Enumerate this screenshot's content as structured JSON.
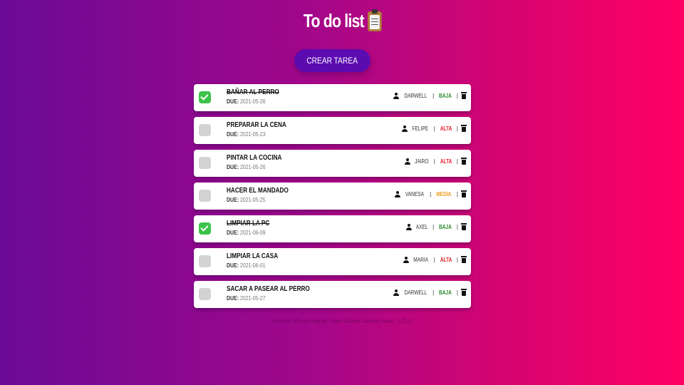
{
  "header": {
    "title": "To do list",
    "title_icon": "clipboard-icon"
  },
  "create_button": {
    "label": "CREAR TAREA"
  },
  "due_label": "DUE:",
  "colors": {
    "priority_baja": "#2a8a2a",
    "priority_alta": "#e8202a",
    "priority_media": "#f0a020",
    "checkbox_done": "#3cc24a",
    "checkbox_pending": "#d3d3d3",
    "button_bg": "#5b0bb0"
  },
  "tasks": [
    {
      "name": "BAÑAR AL PERRO",
      "due": "2021-05-26",
      "done": true,
      "assignee": "DARWELL",
      "priority": "BAJA",
      "priority_color": "#2a8a2a"
    },
    {
      "name": "PREPARAR LA CENA",
      "due": "2021-05-23",
      "done": false,
      "assignee": "FELIPE",
      "priority": "ALTA",
      "priority_color": "#e8202a"
    },
    {
      "name": "PINTAR LA COCINA",
      "due": "2021-05-26",
      "done": false,
      "assignee": "JAIRO",
      "priority": "ALTA",
      "priority_color": "#e8202a"
    },
    {
      "name": "HACER EL MANDADO",
      "due": "2021-05-25",
      "done": false,
      "assignee": "VANESA",
      "priority": "MEDIA",
      "priority_color": "#f0a020"
    },
    {
      "name": "LIMPIAR LA PC",
      "due": "2021-06-09",
      "done": true,
      "assignee": "AXEL",
      "priority": "BAJA",
      "priority_color": "#2a8a2a"
    },
    {
      "name": "LIMPIAR LA CASA",
      "due": "2021-06-01",
      "done": false,
      "assignee": "MARIA",
      "priority": "ALTA",
      "priority_color": "#e8202a"
    },
    {
      "name": "SACAR A PASEAR AL PERRO",
      "due": "2021-05-27",
      "done": false,
      "assignee": "DARWELL",
      "priority": "BAJA",
      "priority_color": "#2a8a2a"
    }
  ],
  "footer": {
    "text": "Proyecto ToDo en Angular - Bane Darwell Sánchez Anleu - UTL ©"
  }
}
